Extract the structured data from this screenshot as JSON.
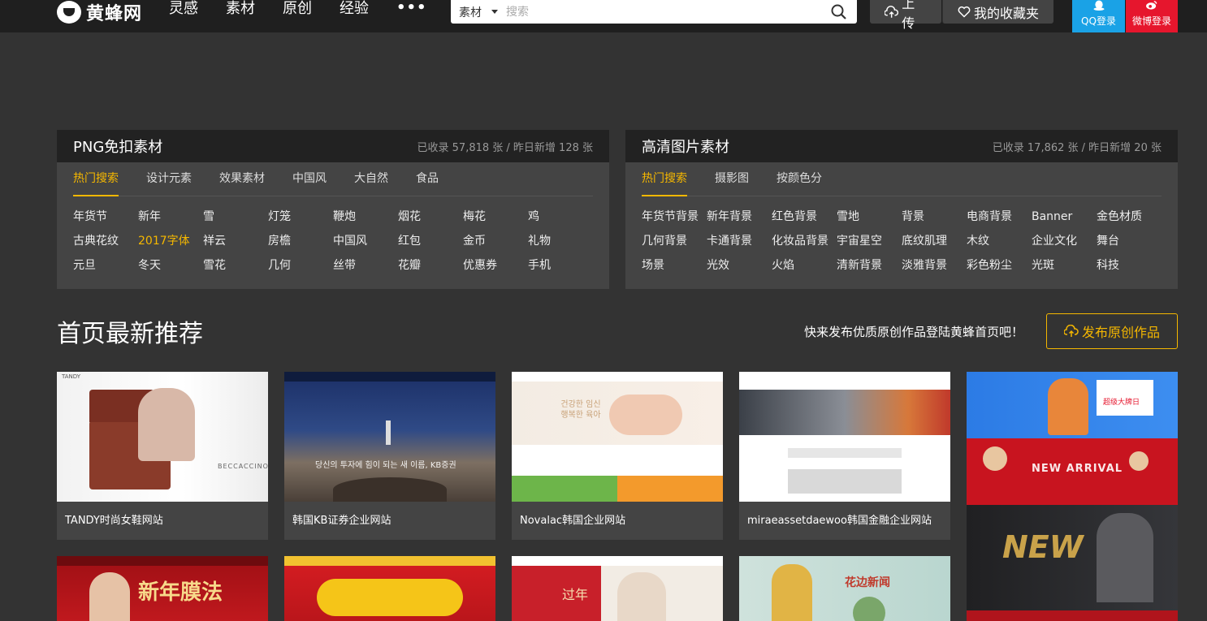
{
  "header": {
    "logo_text": "黄蜂网",
    "nav": [
      "灵感",
      "素材",
      "原创",
      "经验"
    ],
    "more": "•••",
    "search": {
      "type": "素材",
      "placeholder": "搜索"
    },
    "upload_label": "上传",
    "favorites_label": "我的收藏夹",
    "qq_login": "QQ登录",
    "weibo_login": "微博登录"
  },
  "png_panel": {
    "title": "PNG免扣素材",
    "stats": "已收录 57,818 张 / 昨日新增 128 张",
    "tabs": [
      "热门搜索",
      "设计元素",
      "效果素材",
      "中国风",
      "大自然",
      "食品"
    ],
    "links": [
      "年货节",
      "新年",
      "雪",
      "灯笼",
      "鞭炮",
      "烟花",
      "梅花",
      "鸡",
      "古典花纹",
      "2017字体",
      "祥云",
      "房檐",
      "中国风",
      "红包",
      "金币",
      "礼物",
      "元旦",
      "冬天",
      "雪花",
      "几何",
      "丝带",
      "花瓣",
      "优惠券",
      "手机"
    ],
    "highlight": "2017字体"
  },
  "hd_panel": {
    "title": "高清图片素材",
    "stats": "已收录 17,862 张 / 昨日新增 20 张",
    "tabs": [
      "热门搜索",
      "摄影图",
      "按颜色分"
    ],
    "links": [
      "年货节背景",
      "新年背景",
      "红色背景",
      "雪地",
      "背景",
      "电商背景",
      "Banner",
      "金色材质",
      "几何背景",
      "卡通背景",
      "化妆品背景",
      "宇宙星空",
      "底纹肌理",
      "木纹",
      "企业文化",
      "舞台",
      "场景",
      "光效",
      "火焰",
      "清新背景",
      "淡雅背景",
      "彩色粉尘",
      "光斑",
      "科技"
    ]
  },
  "section": {
    "title": "首页最新推荐",
    "promo": "快来发布优质原创作品登陆黄蜂首页吧！",
    "publish_label": "发布原创作品"
  },
  "cards": [
    {
      "caption": "TANDY时尚女鞋网站",
      "thumb_text": "BECCACCINO",
      "brand": "TANDY"
    },
    {
      "caption": "韩国KB证券企业网站",
      "thumb_text": "당신의 투자에 힘이 되는 새 이름, KB증권"
    },
    {
      "caption": "Novalac韩国企业网站",
      "thumb_text": "건강한 임신 행복한 육아"
    },
    {
      "caption": "miraeassetdaewoo韩国金融企业网站",
      "thumb_text": ""
    }
  ],
  "row2_texts": [
    "新年膜法",
    "",
    "过年",
    "花边新闻"
  ],
  "tall_texts": [
    "超级大牌日",
    "NEW ARRIVAL",
    "NEW"
  ],
  "colors": {
    "accent": "#f5b700",
    "qq": "#1aa2e6",
    "weibo": "#e6162d",
    "bg": "#333333",
    "panel": "#444444"
  }
}
